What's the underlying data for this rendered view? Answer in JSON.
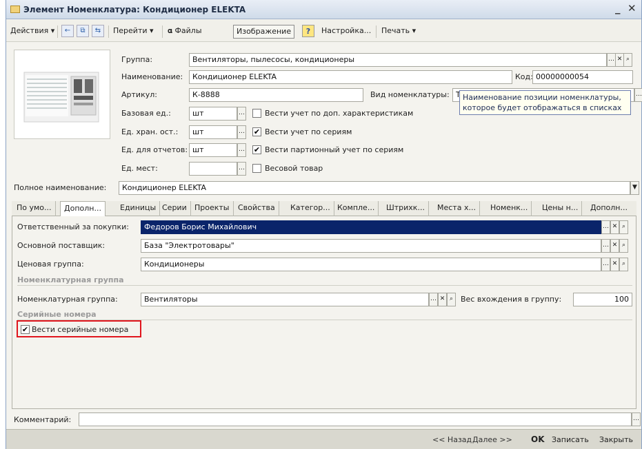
{
  "window": {
    "title": "Элемент Номенклатура: Кондиционер ELEKTA",
    "minimize": "_",
    "close": "✕"
  },
  "toolbar": {
    "actions": "Действия ▾",
    "goto": "Перейти ▾",
    "files": "Файлы",
    "image": "Изображение",
    "help": "?",
    "settings": "Настройка...",
    "print": "Печать ▾"
  },
  "form": {
    "group_label": "Группа:",
    "group_value": "Вентиляторы, пылесосы, кондиционеры",
    "name_label": "Наименование:",
    "name_value": "Кондиционер ELEKTA",
    "code_label": "Код:",
    "code_value": "00000000054",
    "article_label": "Артикул:",
    "article_value": "К-8888",
    "kind_label": "Вид номенклатуры:",
    "kind_value": "Т",
    "tooltip": [
      "Наименование позиции номенклатуры,",
      "которое будет отображаться в списках"
    ],
    "base_unit_label": "Базовая ед.:",
    "base_unit_value": "шт",
    "store_unit_label": "Ед. хран. ост.:",
    "store_unit_value": "шт",
    "report_unit_label": "Ед. для отчетов:",
    "report_unit_value": "шт",
    "places_unit_label": "Ед. мест:",
    "places_unit_value": "",
    "chk_chars": "Вести учет по доп. характеристикам",
    "chk_series": "Вести учет по сериям",
    "chk_batch": "Вести партионный учет по сериям",
    "chk_weight": "Весовой товар",
    "full_name_label": "Полное наименование:",
    "full_name_value": "Кондиционер ELEKTA"
  },
  "tabs": [
    "По умо...",
    "Дополн...",
    "Единицы",
    "Серии",
    "Проекты",
    "Свойства",
    "Категор...",
    "Компле...",
    "Штрихк...",
    "Места х...",
    "Номенк...",
    "Цены н...",
    "Дополн..."
  ],
  "tab_panel": {
    "buyer_label": "Ответственный за покупки:",
    "buyer_value": "Федоров Борис Михайлович",
    "supplier_label": "Основной поставщик:",
    "supplier_value": "База \"Электротовары\"",
    "price_group_label": "Ценовая группа:",
    "price_group_value": "Кондиционеры",
    "section_nom_group": "Номенклатурная группа",
    "nom_group_label": "Номенклатурная группа:",
    "nom_group_value": "Вентиляторы",
    "weight_label": "Вес вхождения в группу:",
    "weight_value": "100",
    "section_serial": "Серийные номера",
    "serial_checkbox": "Вести серийные номера"
  },
  "comment_label": "Комментарий:",
  "comment_value": "",
  "status": {
    "back": "<< Назад",
    "next": "Далее >>",
    "ok": "OK",
    "save": "Записать",
    "close": "Закрыть"
  },
  "colors": {
    "selection": "#0a246a",
    "highlight_box": "#e0151d"
  }
}
